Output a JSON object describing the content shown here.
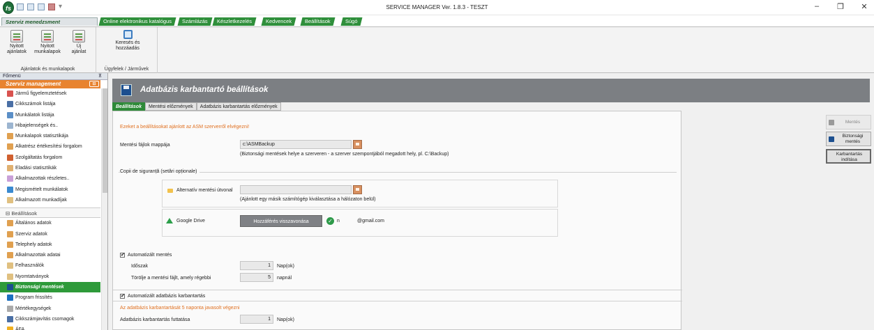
{
  "window": {
    "title": "SERVICE MANAGER Ver. 1.8.3 - TESZT",
    "logo_text": "fs",
    "controls": [
      "–",
      "❐",
      "✕"
    ]
  },
  "ribbon_tabs": [
    {
      "label": "Szerviz menedzsment",
      "active": true
    },
    {
      "label": "Online elektronikus katalógus",
      "active": false
    },
    {
      "label": "Számlázás",
      "active": false
    },
    {
      "label": "Készletkezelés",
      "active": false
    },
    {
      "label": "Kedvencek",
      "active": false
    },
    {
      "label": "Beállítások",
      "active": false
    },
    {
      "label": "Súgó",
      "active": false
    }
  ],
  "ribbon": {
    "group1": {
      "label": "Ajánlatok és munkalapok",
      "buttons": [
        {
          "line1": "Nyitott",
          "line2": "ajánlatok"
        },
        {
          "line1": "Nyitott",
          "line2": "munkalapok"
        },
        {
          "line1": "Új",
          "line2": "ajánlat"
        }
      ]
    },
    "group2": {
      "label": "Ügyfelek / Járművek",
      "buttons": [
        {
          "line1": "Keresés és",
          "line2": "hozzáadás"
        }
      ]
    }
  },
  "leftnav": {
    "fomenu_label": "Főmenü",
    "pin": "⊼",
    "header": "Szerviz management",
    "header_button": "⊟",
    "items": [
      {
        "label": "Jármű figyelemztetések",
        "color": "#d9534f"
      },
      {
        "label": "Cikkszámok listája",
        "color": "#4a6fa5"
      },
      {
        "label": "Munkálatok listája",
        "color": "#5b8fc7"
      },
      {
        "label": "Hibajelenségek és..",
        "color": "#9cb5d0"
      },
      {
        "label": "Munkalapok statisztikája",
        "color": "#e0a050"
      },
      {
        "label": "Alkatrész értékesítési forgalom",
        "color": "#e0a050"
      },
      {
        "label": "Szolgáltatás forgalom",
        "color": "#d06030"
      },
      {
        "label": "Eladási statisztikák",
        "color": "#e0b070"
      },
      {
        "label": "Alkalmazottak részletes..",
        "color": "#c9a0d8"
      },
      {
        "label": "Megismételt munkálatok",
        "color": "#3a8ad0"
      },
      {
        "label": "Alkalmazott munkadíjak",
        "color": "#e0c080"
      }
    ],
    "section": "⊟ Beállítások",
    "settings_items": [
      {
        "label": "Általános adatok",
        "color": "#e0a050",
        "active": false
      },
      {
        "label": "Szerviz adatok",
        "color": "#e0a050",
        "active": false
      },
      {
        "label": "Telephely adatok",
        "color": "#e0a050",
        "active": false
      },
      {
        "label": "Alkalmazottak adatai",
        "color": "#e0a050",
        "active": false
      },
      {
        "label": "Felhasználók",
        "color": "#e0c080",
        "active": false
      },
      {
        "label": "Nyomtatványok",
        "color": "#e0c080",
        "active": false
      },
      {
        "label": "Biztonsági mentések",
        "color": "#1c4f8f",
        "active": true
      },
      {
        "label": "Program frissítés",
        "color": "#1c6fbf",
        "active": false
      },
      {
        "label": "Mértékegységek",
        "color": "#aaaaaa",
        "active": false
      },
      {
        "label": "Cikkszámjavítás csomagok",
        "color": "#4a6fa5",
        "active": false
      },
      {
        "label": "ÁFA",
        "color": "#f0b020",
        "active": false
      }
    ]
  },
  "main": {
    "title": "Adatbázis karbantartó beállítások",
    "subtabs": [
      {
        "label": "Beállítások",
        "active": true
      },
      {
        "label": "Mentési előzmények",
        "active": false
      },
      {
        "label": "Adatbázis karbantartás előzmények",
        "active": false
      }
    ],
    "warning1": "Ezeket a beállításokat ajánlott az ASM szerverről elvégezni!",
    "backup_folder_label": "Mentési fájlok mappája",
    "backup_folder_value": "c:\\ASMBackup",
    "backup_folder_hint": "(Biztonsági mentések helye a szerveren - a szerver szempontjából megadott hely, pl. C:\\Backup)",
    "copies_label": "Copii de siguranță (setări opționale)",
    "alt_path_label": "Alternatív mentési útvonal",
    "alt_path_value": "",
    "alt_path_hint": "(Ajánlott egy másik számítógép kiválasztása a hálózaton belül)",
    "gdrive_label": "Google Drive",
    "gdrive_button": "Hozzáférés visszavonása",
    "gdrive_email_prefix": "n",
    "gdrive_email_suffix": "@gmail.com",
    "auto_backup_label": "Automatizált mentés",
    "auto_backup_checked": "✔",
    "period_label": "Időszak",
    "period_value": "1",
    "period_unit": "Nap(ok)",
    "delete_label": "Törölje a mentési fájlt, amely régebbi",
    "delete_value": "5",
    "delete_unit": "napnál",
    "auto_maint_label": "Automatizált adatbázis karbantartás",
    "auto_maint_checked": "✔",
    "warning2": "Az adatbázis karbantartását 5 naponta javasolt végezni",
    "maint_run_label": "Adatbázis karbantartás futtatása",
    "maint_run_value": "1",
    "maint_run_unit": "Nap(ok)"
  },
  "actions": [
    {
      "line1": "Mentés",
      "line2": "",
      "style": "disabled",
      "icon_color": "#9a9a9a"
    },
    {
      "line1": "Biztonsági",
      "line2": "mentés",
      "style": "primary",
      "icon_color": "#1c4f8f"
    },
    {
      "line1": "Karbantartás",
      "line2": "indítása",
      "style": "outlined",
      "icon_color": ""
    }
  ],
  "colors": {
    "accent_green": "#2e8a38",
    "accent_orange": "#e8832f",
    "header_gray": "#7c7f83"
  }
}
